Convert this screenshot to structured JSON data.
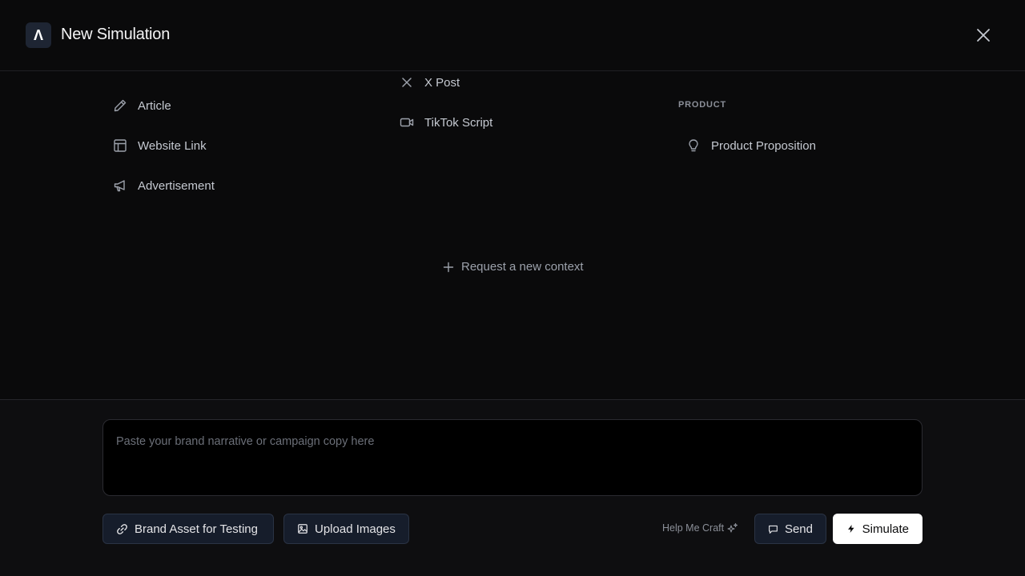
{
  "header": {
    "logo_glyph": "Λ",
    "title": "New Simulation"
  },
  "contexts": {
    "col1": [
      {
        "label": "Article",
        "icon": "pencil-icon"
      },
      {
        "label": "Website Link",
        "icon": "layout-icon"
      },
      {
        "label": "Advertisement",
        "icon": "megaphone-icon"
      }
    ],
    "col2": [
      {
        "label": "X Post",
        "icon": "x-icon"
      },
      {
        "label": "TikTok Script",
        "icon": "video-icon"
      }
    ],
    "col3_section": "PRODUCT",
    "col3": [
      {
        "label": "Product Proposition",
        "icon": "lightbulb-icon"
      }
    ],
    "request_label": "Request a new context"
  },
  "composer": {
    "placeholder": "Paste your brand narrative or campaign copy here",
    "value": ""
  },
  "actions": {
    "brand_asset_label": "Brand Asset for Testing",
    "upload_label": "Upload Images",
    "help_label": "Help Me Craft",
    "send_label": "Send",
    "simulate_label": "Simulate"
  },
  "colors": {
    "background": "#0a0a0b",
    "panel": "#0e0e10",
    "button_dark": "#161d2b",
    "primary_button": "#ffffff"
  }
}
